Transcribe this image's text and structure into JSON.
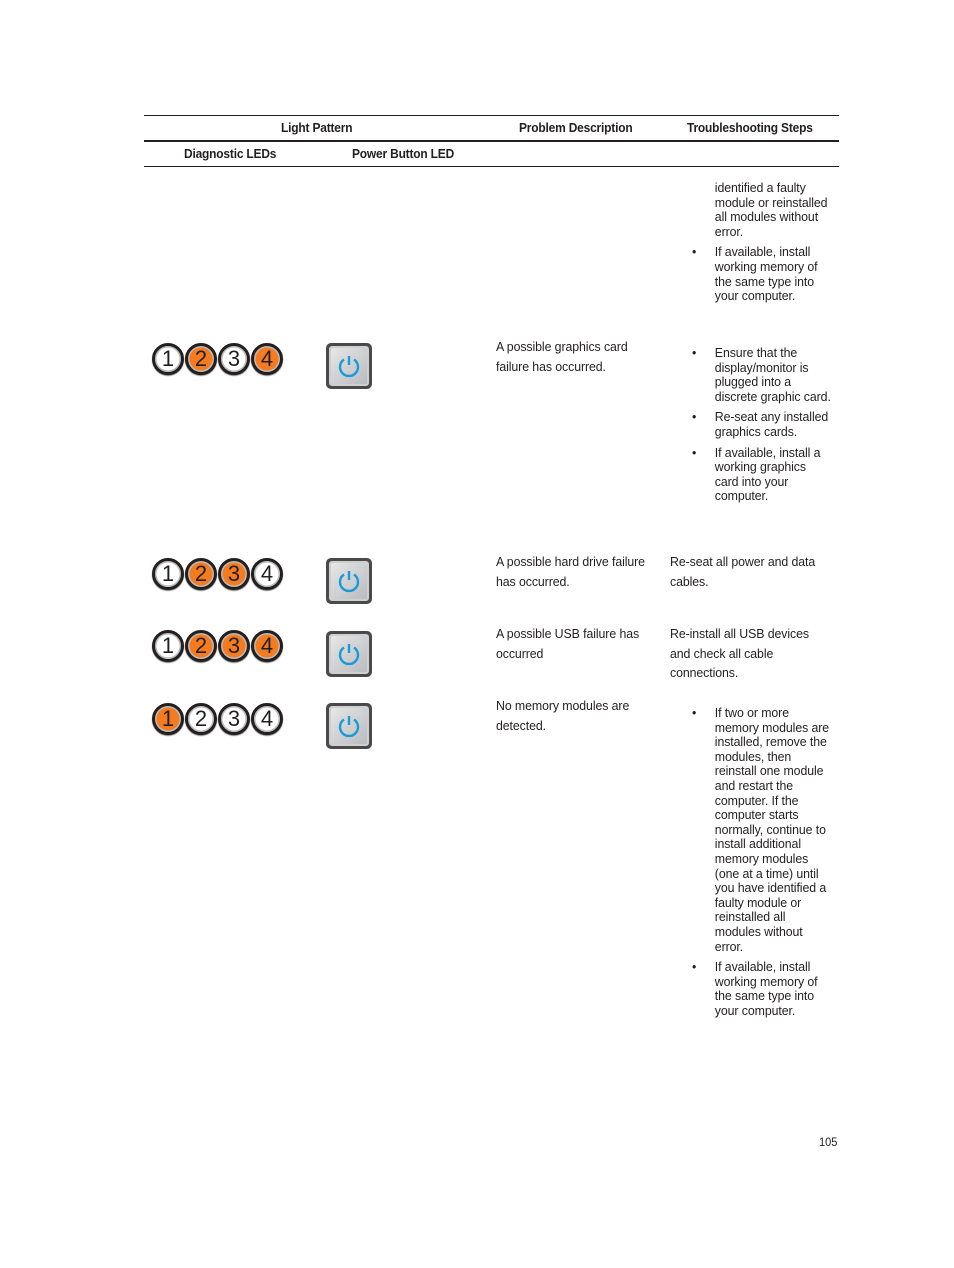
{
  "table": {
    "headers": {
      "light_pattern": "Light Pattern",
      "problem_description": "Problem Description",
      "troubleshooting_steps": "Troubleshooting Steps",
      "diagnostic_leds": "Diagnostic LEDs",
      "power_button_led": "Power Button LED"
    },
    "continued_steps": {
      "fragment": "identified a faulty module or reinstalled all modules without error.",
      "items": [
        "If available, install working memory of the same type into your computer."
      ]
    },
    "rows": [
      {
        "leds": [
          {
            "label": "1",
            "state": "off"
          },
          {
            "label": "2",
            "state": "on"
          },
          {
            "label": "3",
            "state": "off"
          },
          {
            "label": "4",
            "state": "on"
          }
        ],
        "power_led": "blue",
        "problem": "A possible graphics card failure has occurred.",
        "steps": [
          "Ensure that the display/monitor is plugged into a discrete graphic card.",
          "Re-seat any installed graphics cards.",
          "If available, install a working graphics card into your computer."
        ]
      },
      {
        "leds": [
          {
            "label": "1",
            "state": "off"
          },
          {
            "label": "2",
            "state": "on"
          },
          {
            "label": "3",
            "state": "on"
          },
          {
            "label": "4",
            "state": "off"
          }
        ],
        "power_led": "blue",
        "problem": "A possible hard drive failure has occurred.",
        "steps_text": "Re-seat all power and data cables."
      },
      {
        "leds": [
          {
            "label": "1",
            "state": "off"
          },
          {
            "label": "2",
            "state": "on"
          },
          {
            "label": "3",
            "state": "on"
          },
          {
            "label": "4",
            "state": "on"
          }
        ],
        "power_led": "blue",
        "problem": "A possible USB failure has occurred",
        "steps_text": "Re-install all USB devices and check all cable connections."
      },
      {
        "leds": [
          {
            "label": "1",
            "state": "on"
          },
          {
            "label": "2",
            "state": "off"
          },
          {
            "label": "3",
            "state": "off"
          },
          {
            "label": "4",
            "state": "off"
          }
        ],
        "power_led": "blue",
        "problem": "No memory modules are detected.",
        "steps": [
          "If two or more memory modules are installed, remove the modules, then reinstall one module and restart the computer. If the computer starts normally, continue to install additional memory modules (one at a time) until you have identified a faulty module or reinstalled all modules without error.",
          "If available, install working memory of the same type into your computer."
        ]
      }
    ]
  },
  "bullet_char": "•",
  "colors": {
    "led_on": "#f47b20",
    "power_icon": "#1a9ad6"
  },
  "page_number": "105"
}
